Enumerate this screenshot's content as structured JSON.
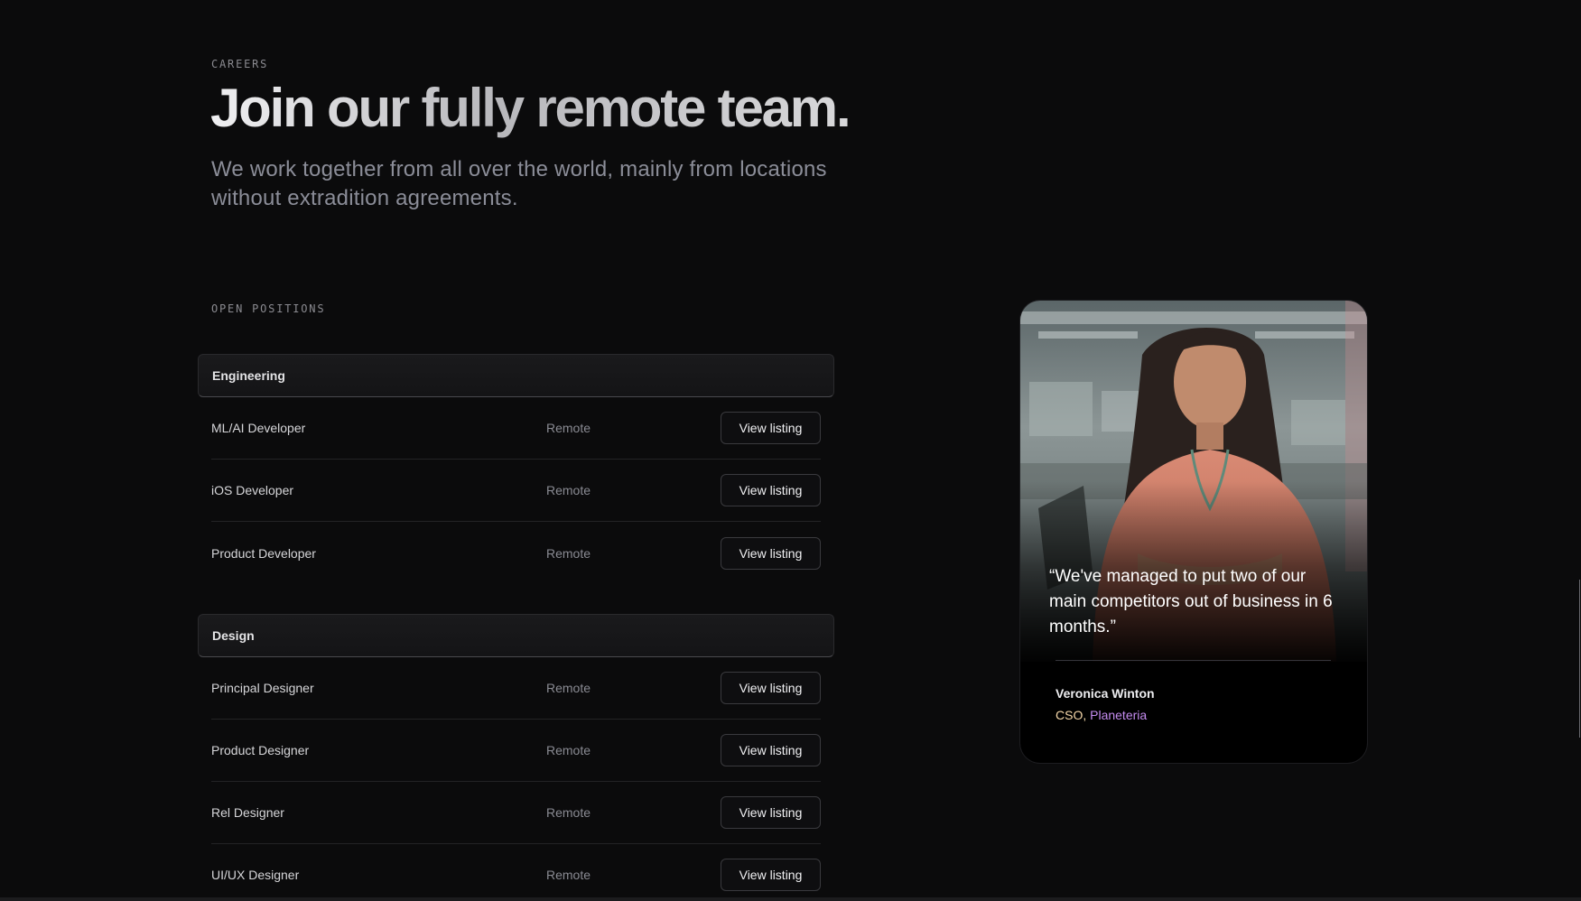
{
  "hero": {
    "eyebrow": "CAREERS",
    "title": "Join our fully remote team.",
    "subtitle": "We work together from all over the world, mainly from locations without extradition agreements."
  },
  "positions": {
    "label": "OPEN POSITIONS",
    "departments": [
      {
        "name": "Engineering",
        "jobs": [
          {
            "title": "ML/AI Developer",
            "location": "Remote",
            "action": "View listing"
          },
          {
            "title": "iOS Developer",
            "location": "Remote",
            "action": "View listing"
          },
          {
            "title": "Product Developer",
            "location": "Remote",
            "action": "View listing"
          }
        ]
      },
      {
        "name": "Design",
        "jobs": [
          {
            "title": "Principal Designer",
            "location": "Remote",
            "action": "View listing"
          },
          {
            "title": "Product Designer",
            "location": "Remote",
            "action": "View listing"
          },
          {
            "title": "Rel Designer",
            "location": "Remote",
            "action": "View listing"
          },
          {
            "title": "UI/UX Designer",
            "location": "Remote",
            "action": "View listing"
          }
        ]
      }
    ]
  },
  "testimonial": {
    "quote": "“We've managed to put two of our main competitors out of business in 6 months.”",
    "author": "Veronica Winton",
    "role": "CSO,",
    "company": "Planeteria"
  },
  "colors": {
    "background": "#0b0b0c",
    "role_accent": "#f4d6a8",
    "company_accent": "#c58cf0"
  }
}
